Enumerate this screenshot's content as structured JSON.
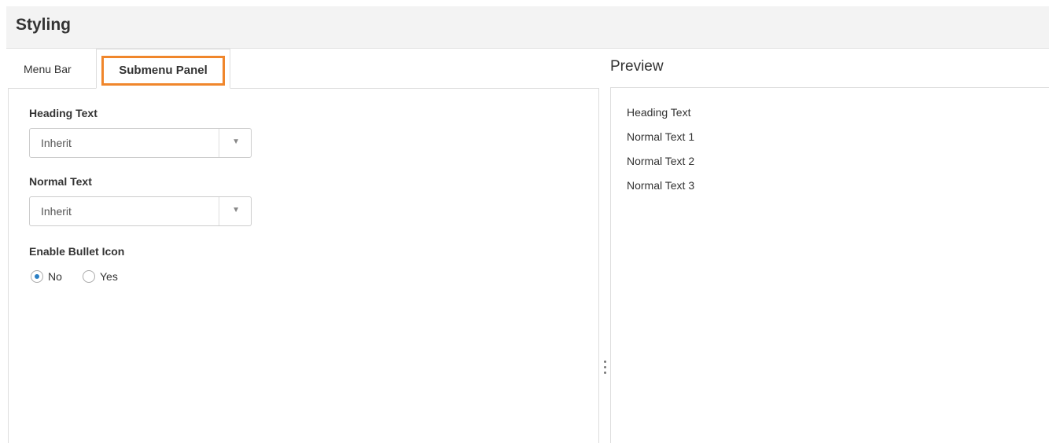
{
  "header": {
    "title": "Styling"
  },
  "tabs": [
    {
      "label": "Menu Bar",
      "active": false
    },
    {
      "label": "Submenu Panel",
      "active": true
    }
  ],
  "form": {
    "heading_text": {
      "label": "Heading Text",
      "value": "Inherit"
    },
    "normal_text": {
      "label": "Normal Text",
      "value": "Inherit"
    },
    "bullet_icon": {
      "label": "Enable Bullet Icon",
      "options": [
        {
          "label": "No",
          "checked": true
        },
        {
          "label": "Yes",
          "checked": false
        }
      ]
    }
  },
  "preview": {
    "title": "Preview",
    "items": [
      "Heading Text",
      "Normal Text 1",
      "Normal Text 2",
      "Normal Text 3"
    ]
  },
  "colors": {
    "tab_highlight": "#f0862b",
    "radio_accent": "#2a7fc4",
    "header_bg": "#f3f3f3"
  }
}
